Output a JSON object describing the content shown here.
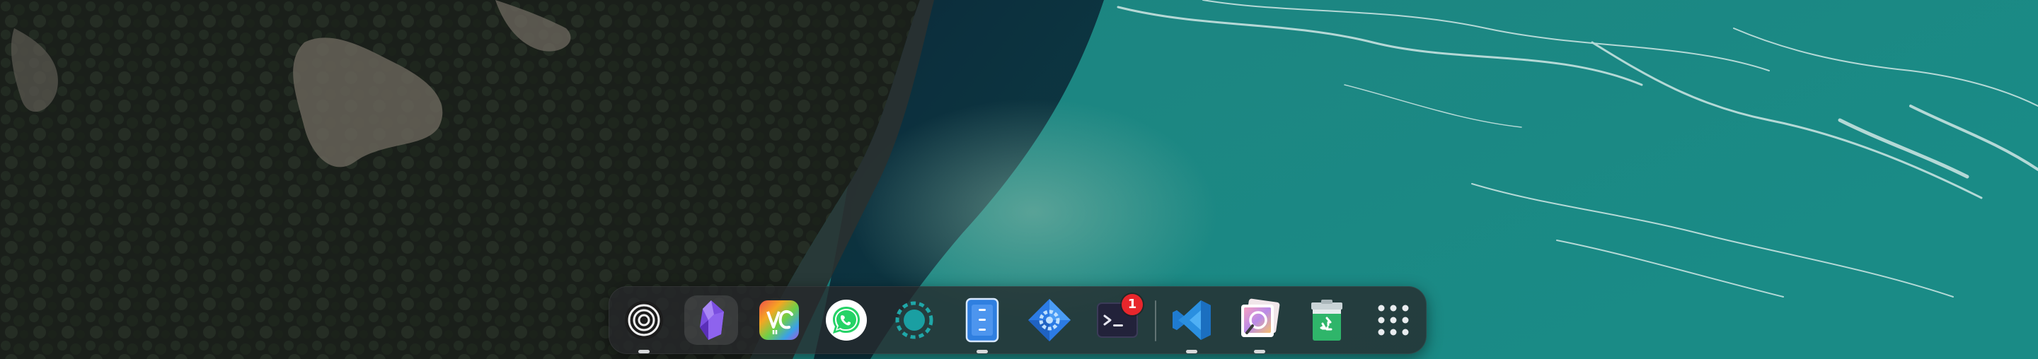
{
  "desktop": {
    "wallpaper": "aerial-coastline-turquoise-water"
  },
  "dock": {
    "background": "#26282a",
    "items": [
      {
        "name": "multitasking-view",
        "icon": "concentric-rings-icon",
        "running": true,
        "active": false
      },
      {
        "name": "obsidian",
        "icon": "obsidian-crystal-icon",
        "running": false,
        "active": true
      },
      {
        "name": "vc-app",
        "icon": "vc-rainbow-icon",
        "running": false,
        "active": false
      },
      {
        "name": "whatsapp",
        "icon": "whatsapp-icon",
        "running": false,
        "active": false
      },
      {
        "name": "loader-app",
        "icon": "dotted-ring-icon",
        "running": false,
        "active": false
      },
      {
        "name": "file-manager",
        "icon": "file-manager-icon",
        "running": true,
        "active": false
      },
      {
        "name": "app-store",
        "icon": "gear-diamond-icon",
        "running": false,
        "active": false
      },
      {
        "name": "terminal",
        "icon": "terminal-icon",
        "running": false,
        "active": false,
        "badge": "1"
      },
      {
        "name": "vscode",
        "icon": "vscode-icon",
        "running": true,
        "active": false
      },
      {
        "name": "image-viewer",
        "icon": "photo-viewer-icon",
        "running": true,
        "active": false
      },
      {
        "name": "trash",
        "icon": "recycle-bin-icon",
        "running": false,
        "active": false
      },
      {
        "name": "launcher",
        "icon": "app-grid-icon",
        "running": false,
        "active": false
      }
    ]
  },
  "colors": {
    "water": "#1f8a84",
    "badge": "#e8262c",
    "vscode_blue": "#2a8fe0",
    "whatsapp_green": "#25d366"
  }
}
